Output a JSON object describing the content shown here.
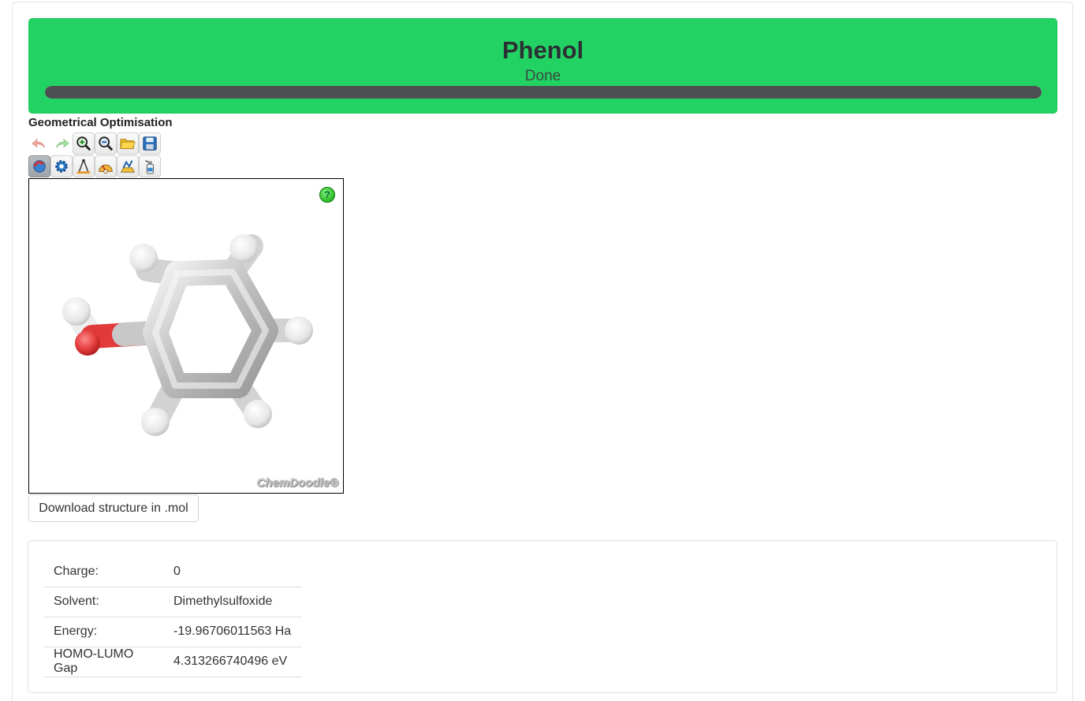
{
  "banner": {
    "title": "Phenol",
    "status": "Done",
    "progress_percent": 100,
    "color": "#22d364"
  },
  "section": {
    "title": "Geometrical Optimisation"
  },
  "toolbar": {
    "row1": [
      "undo-icon",
      "redo-icon",
      "zoom-in-icon",
      "zoom-out-icon",
      "open-folder-icon",
      "save-disk-icon"
    ],
    "row2": [
      "rotate-icon",
      "settings-gear-icon",
      "measure-distance-icon",
      "measure-angle-icon",
      "measure-torsion-icon",
      "clear-spray-icon"
    ]
  },
  "viewer": {
    "help_label": "?",
    "watermark": "ChemDoodle®",
    "atom_colors": {
      "carbon": "#c8c8c8",
      "hydrogen": "#f2f2f2",
      "oxygen": "#e23a3a"
    }
  },
  "download": {
    "label": "Download structure in .mol"
  },
  "properties": [
    {
      "label": "Charge:",
      "value": "0"
    },
    {
      "label": "Solvent:",
      "value": "Dimethylsulfoxide"
    },
    {
      "label": "Energy:",
      "value": "-19.96706011563 Ha"
    },
    {
      "label": "HOMO-LUMO Gap",
      "value": "4.313266740496 eV"
    }
  ]
}
